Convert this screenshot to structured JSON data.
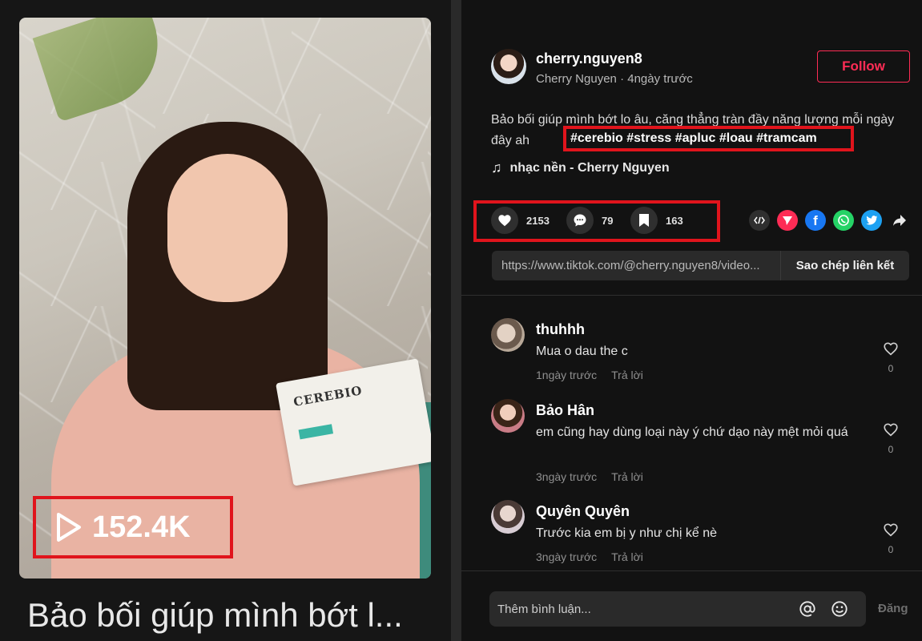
{
  "video": {
    "views": "152.4K",
    "caption_title": "Bảo bối giúp mình bớt l...",
    "product_label": "CEREBIO"
  },
  "author": {
    "username": "cherry.nguyen8",
    "display_name": "Cherry Nguyen",
    "time": "4ngày trước",
    "follow_label": "Follow"
  },
  "post": {
    "description": "Bảo bối giúp mình bớt lo âu, căng thẳng tràn đầy năng lượng mỗi ngày đây ah",
    "hashtags": "#cerebio #stress #apluc #loau #tramcam",
    "music": "nhạc nền - Cherry Nguyen"
  },
  "stats": {
    "likes": "2153",
    "comments": "79",
    "saves": "163"
  },
  "share": {
    "icons": [
      "embed-icon",
      "send-icon",
      "facebook-icon",
      "whatsapp-icon",
      "twitter-icon",
      "share-arrow-icon"
    ],
    "colors": {
      "send": "#fe2c55",
      "facebook": "#1877f2",
      "whatsapp": "#25d366",
      "twitter": "#1da1f2"
    }
  },
  "link": {
    "url": "https://www.tiktok.com/@cherry.nguyen8/video...",
    "copy_label": "Sao chép liên kết"
  },
  "comments": [
    {
      "name": "thuhhh",
      "text": "Mua o dau the c",
      "time": "1ngày trước",
      "reply": "Trả lời",
      "likes": "0"
    },
    {
      "name": "Bảo Hân",
      "text": "em cũng hay dùng loại này ý chứ dạo này mệt mỏi quá",
      "time": "3ngày trước",
      "reply": "Trả lời",
      "likes": "0"
    },
    {
      "name": "Quyên Quyên",
      "text": "Trước kia em bị y như chị kể nè",
      "time": "3ngày trước",
      "reply": "Trả lời",
      "likes": "0"
    }
  ],
  "composer": {
    "placeholder": "Thêm bình luận...",
    "post_label": "Đăng"
  },
  "colors": {
    "accent": "#fe2c55",
    "highlight_box": "#e0141c",
    "background": "#121212"
  }
}
